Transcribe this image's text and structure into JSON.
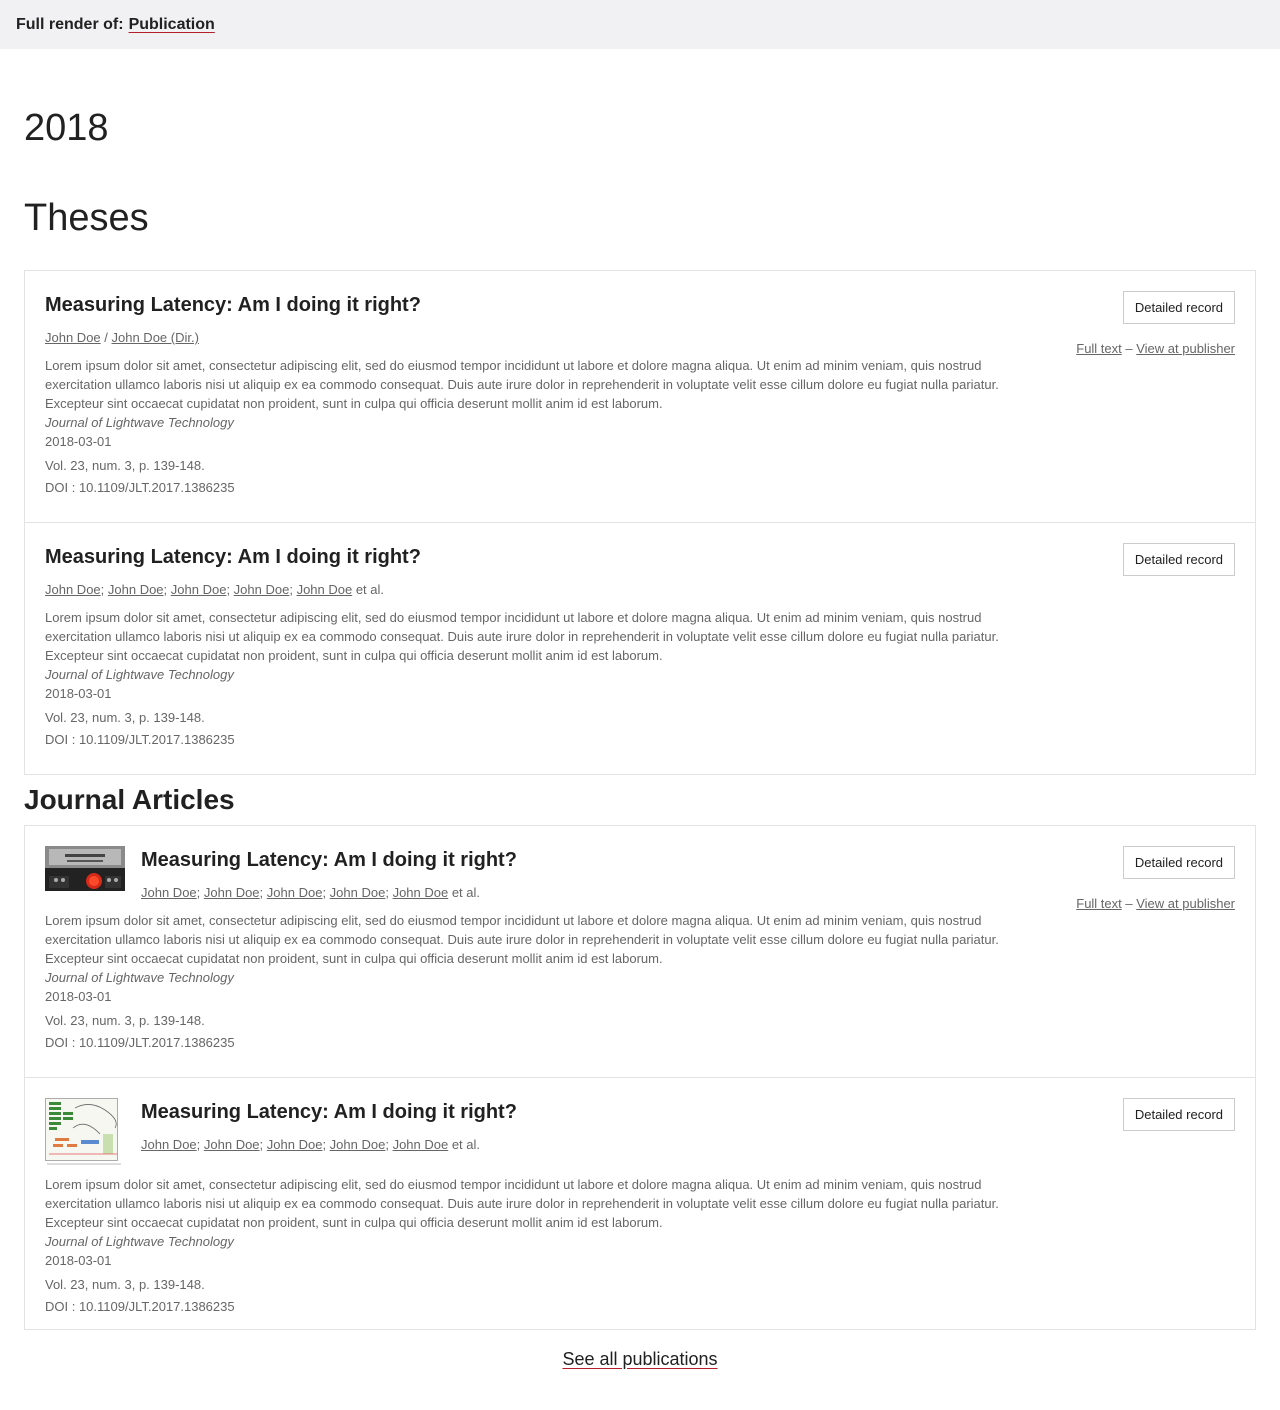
{
  "topbar": {
    "label": "Full render of:",
    "link": "Publication"
  },
  "year": "2018",
  "sections": {
    "theses": "Theses",
    "articles": "Journal Articles"
  },
  "common": {
    "title": "Measuring Latency: Am I doing it right?",
    "author": "John Doe",
    "author_dir": "John Doe (Dir.)",
    "slash": " / ",
    "semicolon": "; ",
    "et_al": " et al.",
    "abstract": "Lorem ipsum dolor sit amet, consectetur adipiscing elit, sed do eiusmod tempor incididunt ut labore et dolore magna aliqua. Ut enim ad minim veniam, quis nostrud exercitation ullamco laboris nisi ut aliquip ex ea commodo consequat. Duis aute irure dolor in reprehenderit in voluptate velit esse cillum dolore eu fugiat nulla pariatur. Excepteur sint occaecat cupidatat non proident, sunt in culpa qui officia deserunt mollit anim id est laborum.",
    "journal": "Journal of Lightwave Technology",
    "date": "2018-03-01",
    "volume": "Vol. 23, num. 3, p. 139-148.",
    "doi": "DOI : 10.1109/JLT.2017.1386235",
    "detailed_record": "Detailed record",
    "full_text": "Full text",
    "dash": " – ",
    "view_at_publisher": "View at publisher"
  },
  "footer": {
    "see_all": "See all publications"
  }
}
